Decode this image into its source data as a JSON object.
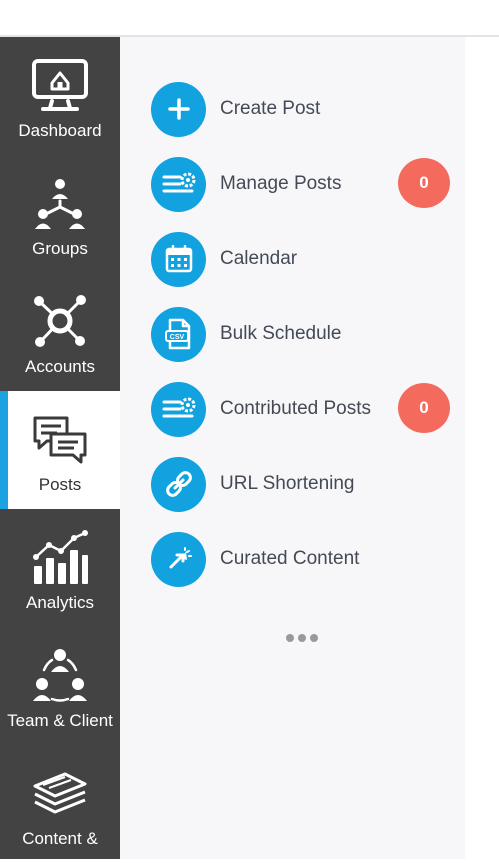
{
  "sidebar": {
    "items": [
      {
        "label": "Dashboard",
        "icon": "monitor-home-icon",
        "active": false
      },
      {
        "label": "Groups",
        "icon": "group-tree-icon",
        "active": false
      },
      {
        "label": "Accounts",
        "icon": "network-hub-icon",
        "active": false
      },
      {
        "label": "Posts",
        "icon": "chat-bubbles-icon",
        "active": true
      },
      {
        "label": "Analytics",
        "icon": "bar-chart-trend-icon",
        "active": false
      },
      {
        "label": "Team & Client",
        "icon": "team-circle-icon",
        "active": false
      },
      {
        "label": "Content &",
        "icon": "stacked-layers-icon",
        "active": false
      }
    ]
  },
  "posts_menu": {
    "items": [
      {
        "label": "Create Post",
        "icon": "plus-icon"
      },
      {
        "label": "Manage Posts",
        "icon": "list-gear-icon",
        "badge": "0"
      },
      {
        "label": "Calendar",
        "icon": "calendar-icon"
      },
      {
        "label": "Bulk Schedule",
        "icon": "csv-file-icon"
      },
      {
        "label": "Contributed Posts",
        "icon": "list-gear-icon",
        "badge": "0"
      },
      {
        "label": "URL Shortening",
        "icon": "link-icon"
      },
      {
        "label": "Curated Content",
        "icon": "cursor-sparkle-icon"
      }
    ],
    "more": "more-horizontal-icon"
  },
  "colors": {
    "sidebar_bg": "#434343",
    "accent": "#12a2df",
    "badge": "#f46b5e",
    "panel_bg": "#f7f7f9"
  }
}
